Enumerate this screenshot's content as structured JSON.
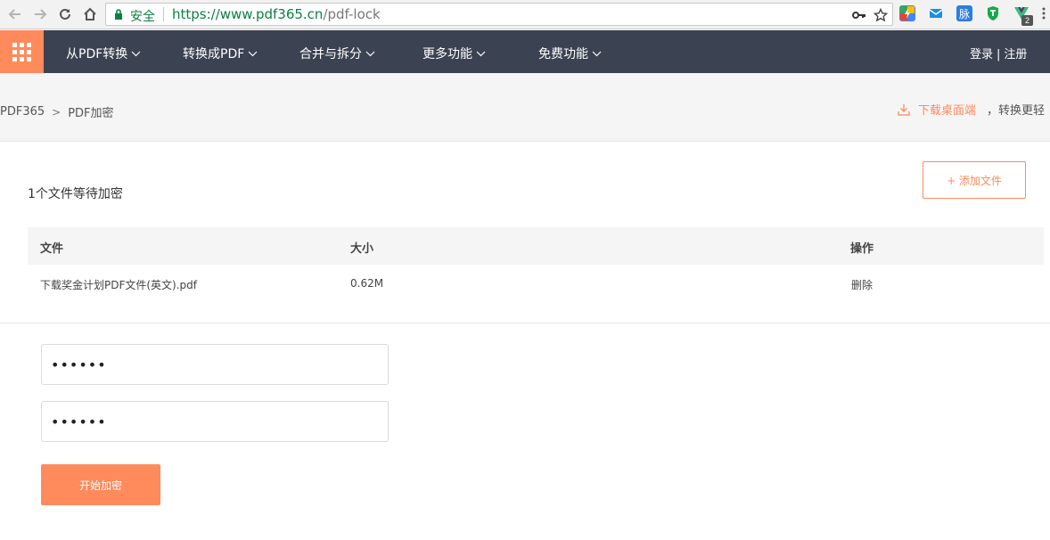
{
  "browser": {
    "secure_label": "安全",
    "url_host": "https://www.pdf365.cn",
    "url_path": "/pdf-lock",
    "ext_badge": "2",
    "ext_label_3": "脉"
  },
  "topnav": {
    "items": [
      {
        "label": "从PDF转换"
      },
      {
        "label": "转换成PDF"
      },
      {
        "label": "合并与拆分"
      },
      {
        "label": "更多功能"
      },
      {
        "label": "免费功能"
      }
    ],
    "login": "登录",
    "separator": "|",
    "register": "注册"
  },
  "breadcrumb": {
    "home": "PDF365",
    "arrow": ">",
    "current": "PDF加密"
  },
  "download": {
    "link": "下载桌面端",
    "tail": "，转换更轻"
  },
  "panel": {
    "count_text": "1个文件等待加密",
    "add_button": "+ 添加文件",
    "table": {
      "headers": [
        "文件",
        "大小",
        "操作"
      ],
      "rows": [
        {
          "file": "下载奖金计划PDF文件(英文).pdf",
          "size": "0.62M",
          "action": "删除"
        }
      ]
    },
    "password_value": "••••••",
    "confirm_value": "••••••",
    "start_button": "开始加密"
  },
  "colors": {
    "accent": "#ff8a5c",
    "nav_bg": "#3b4251",
    "secure_green": "#0b8043"
  }
}
